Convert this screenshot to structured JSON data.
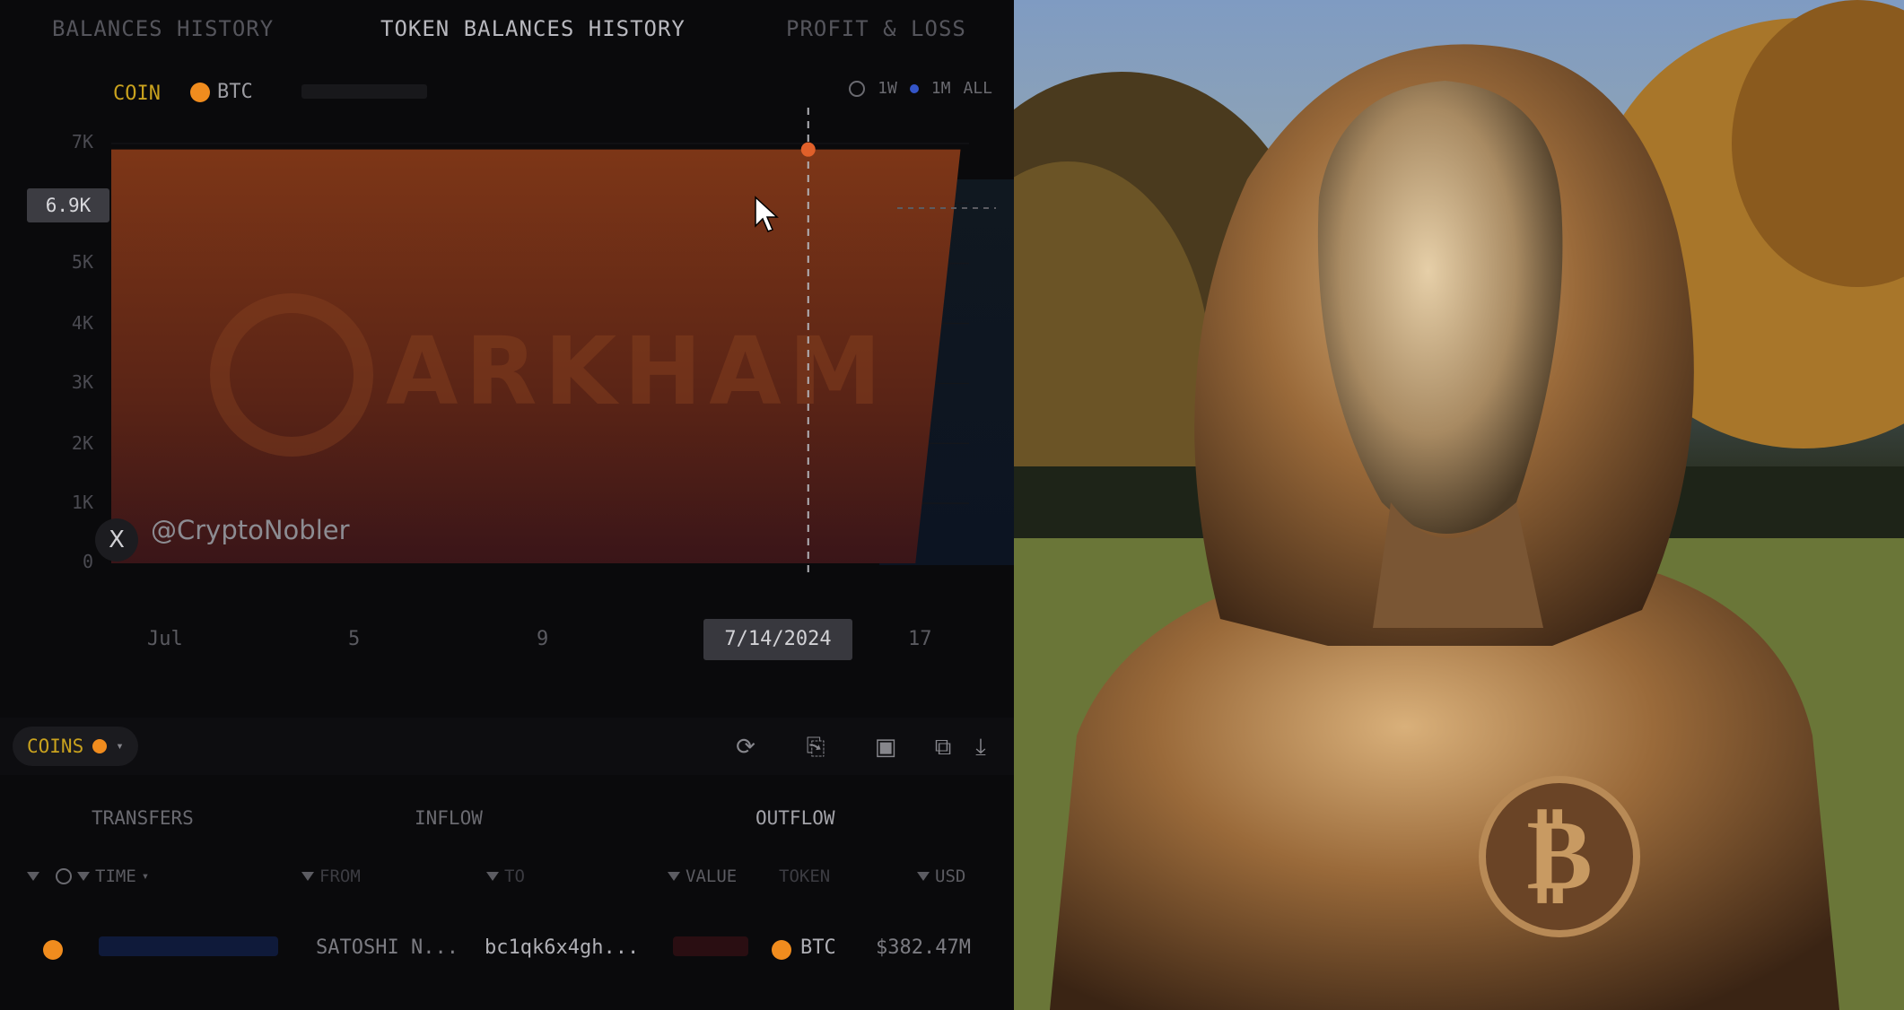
{
  "tabs": [
    "BALANCES HISTORY",
    "TOKEN BALANCES HISTORY",
    "PROFIT & LOSS"
  ],
  "coin_selector": {
    "label": "COIN",
    "value": "BTC"
  },
  "range": [
    "1W",
    "1M",
    "ALL"
  ],
  "y_axis": {
    "ticks": [
      "7K",
      "5K",
      "4K",
      "3K",
      "2K",
      "1K",
      "0"
    ],
    "hover_value": "6.9K"
  },
  "x_axis": {
    "ticks": [
      "Jul",
      "5",
      "9",
      "17"
    ],
    "hover_date": "7/14/2024"
  },
  "watermark": "ARKHAM",
  "social": {
    "icon": "X",
    "handle": "@CryptoNobler"
  },
  "coins_chip": {
    "label": "COINS"
  },
  "subtabs": [
    "TRANSFERS",
    "INFLOW",
    "OUTFLOW"
  ],
  "columns": [
    "TIME",
    "FROM",
    "TO",
    "VALUE",
    "TOKEN",
    "USD"
  ],
  "rows": [
    {
      "from": "SATOSHI N...",
      "to": "bc1qk6x4gh...",
      "token": "BTC",
      "usd": "$382.47M"
    }
  ],
  "colors": {
    "accent_gold": "#c9a21e",
    "btc_orange": "#f08c1e",
    "area_fill": "#7a3418",
    "link_blue": "#3a5fd0"
  },
  "chart_data": {
    "type": "area",
    "x": [
      "7/1/2024",
      "7/14/2024",
      "7/15/2024",
      "7/16/2024",
      "7/17/2024"
    ],
    "values": [
      6900,
      6900,
      6900,
      0,
      0
    ],
    "ylim": [
      0,
      7000
    ],
    "x_tick_labels": [
      "Jul",
      "5",
      "9",
      "17"
    ],
    "title": "",
    "xlabel": "",
    "ylabel": ""
  }
}
